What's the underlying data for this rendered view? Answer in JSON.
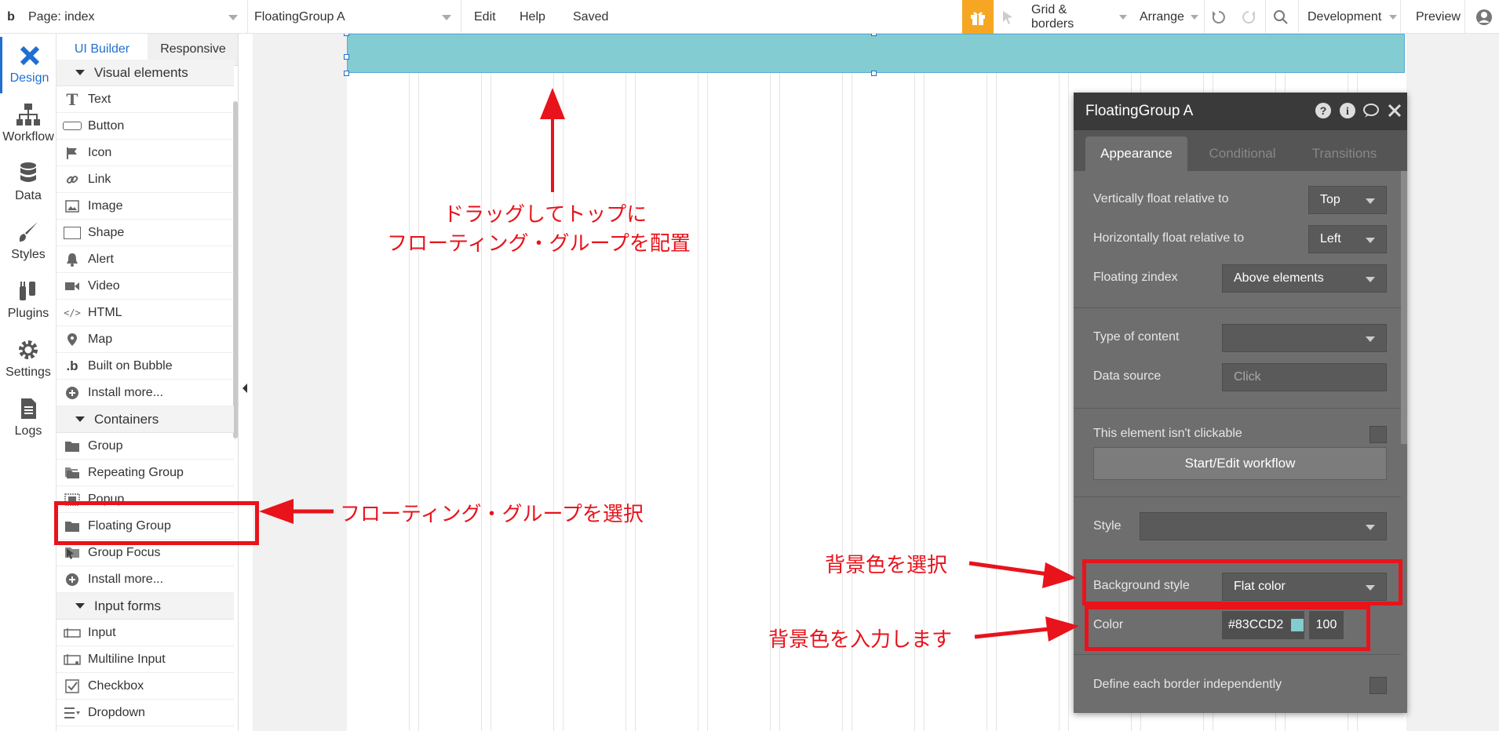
{
  "topbar": {
    "logo": "b",
    "page_selector": "Page: index",
    "element_selector": "FloatingGroup A",
    "edit": "Edit",
    "help": "Help",
    "saved": "Saved",
    "grid_borders": "Grid & borders",
    "arrange": "Arrange",
    "environment": "Development",
    "preview": "Preview"
  },
  "leftnav": {
    "items": [
      {
        "label": "Design",
        "icon": "design-icon"
      },
      {
        "label": "Workflow",
        "icon": "workflow-icon"
      },
      {
        "label": "Data",
        "icon": "database-icon"
      },
      {
        "label": "Styles",
        "icon": "brush-icon"
      },
      {
        "label": "Plugins",
        "icon": "plugin-icon"
      },
      {
        "label": "Settings",
        "icon": "gear-icon"
      },
      {
        "label": "Logs",
        "icon": "document-icon"
      }
    ]
  },
  "palette": {
    "tabs": [
      "UI Builder",
      "Responsive"
    ],
    "sections": {
      "visual": "Visual elements",
      "containers": "Containers",
      "inputs": "Input forms"
    },
    "visual_items": [
      "Text",
      "Button",
      "Icon",
      "Link",
      "Image",
      "Shape",
      "Alert",
      "Video",
      "HTML",
      "Map",
      "Built on Bubble",
      "Install more..."
    ],
    "container_items": [
      "Group",
      "Repeating Group",
      "Popup",
      "Floating Group",
      "Group Focus",
      "Install more..."
    ],
    "input_items": [
      "Input",
      "Multiline Input",
      "Checkbox",
      "Dropdown"
    ]
  },
  "property_editor": {
    "title": "FloatingGroup A",
    "tabs": [
      "Appearance",
      "Conditional",
      "Transitions"
    ],
    "vertically_float_label": "Vertically float relative to",
    "vertically_float_value": "Top",
    "horizontally_float_label": "Horizontally float relative to",
    "horizontally_float_value": "Left",
    "floating_zindex_label": "Floating zindex",
    "floating_zindex_value": "Above elements",
    "type_of_content_label": "Type of content",
    "type_of_content_value": "",
    "data_source_label": "Data source",
    "data_source_placeholder": "Click",
    "not_clickable_label": "This element isn't clickable",
    "workflow_button": "Start/Edit workflow",
    "style_label": "Style",
    "style_value": "",
    "background_style_label": "Background style",
    "background_style_value": "Flat color",
    "color_label": "Color",
    "color_value": "#83CCD2",
    "opacity_value": "100",
    "border_label": "Define each border independently"
  },
  "annotations": {
    "drag_line1": "ドラッグしてトップに",
    "drag_line2": "フローティング・グループを配置",
    "select_group": "フローティング・グループを選択",
    "select_bg": "背景色を選択",
    "input_color": "背景色を入力します"
  },
  "colors": {
    "accent": "#1f6fd0",
    "floating_group": "#83CCD2",
    "annotation": "#e8131b",
    "gift": "#f6a623"
  }
}
